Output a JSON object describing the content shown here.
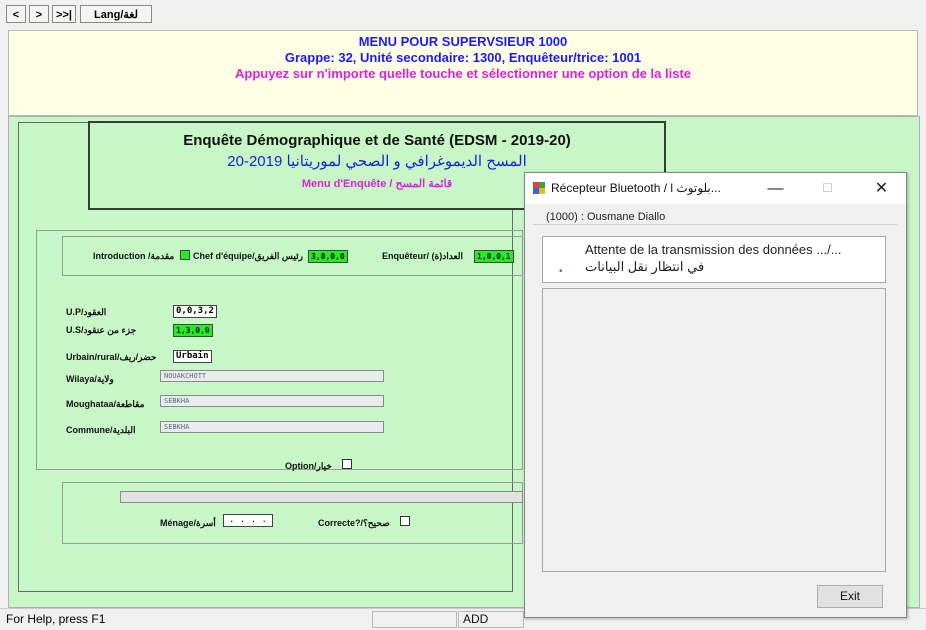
{
  "toolbar": {
    "prev": "<",
    "next": ">",
    "last": ">>|",
    "lang": "Lang/لغة"
  },
  "header": {
    "line1": "MENU POUR SUPERVSIEUR 1000",
    "line2": "Grappe: 32, Unité secondaire: 1300, Enquêteur/trice: 1001",
    "line3": "Appuyez sur n'importe quelle touche et sélectionner une option de la liste"
  },
  "survey": {
    "title": "Enquête Démographique et de Santé (EDSM - 2019-20)",
    "title_ar": "المسح الديموغرافي و الصحي لموريتانيا 2019-20",
    "menu": "Menu d'Enquête / قائمة المسح"
  },
  "form": {
    "intro_label": "Introduction /مقدمة",
    "chef_label": "Chef d'équipe/رئيس الفريق",
    "chef_value": "3,0,0,0",
    "enq_label": "Enquêteur/ (ة)العداد",
    "enq_value": "1,0,0,1",
    "up_label": "U.P/العقود",
    "up_value": "0,0,3,2",
    "us_label": "U.S/جزء من عنقود",
    "us_value": "1,3,0,0",
    "milieu_label": "Urbain/rural/حضر/ريف",
    "milieu_value": "Urbain",
    "wilaya_label": "Wilaya/ولاية",
    "wilaya_value": "NOUAKCHOTT",
    "moughataa_label": "Moughataa/مقاطعة",
    "moughataa_value": "SEBKHA",
    "commune_label": "Commune/البلدية",
    "commune_value": "SEBKHA",
    "option_label": "Option/خيار",
    "menage_label": "Ménage/أسرة",
    "menage_value": ". . . .",
    "correcte_label": "Correcte?/صحيح؟"
  },
  "status": {
    "help": "For Help, press F1",
    "mode": "ADD"
  },
  "dialog": {
    "title": "Récepteur Bluetooth / l بلوتوث...",
    "minimize": "—",
    "maximize": "☐",
    "close": "✕",
    "user": "(1000) : Ousmane Diallo",
    "waiting_fr": "Attente de la transmission des données .../...",
    "waiting_ar": "في انتظار نقل البيانات",
    "exit": "Exit"
  },
  "colors": {
    "header_bg": "#ffffe6",
    "main_bg": "#c7f7c7",
    "blue_text": "#1a1aff",
    "magenta_text": "#e020e0",
    "green_field": "#22ee22"
  }
}
